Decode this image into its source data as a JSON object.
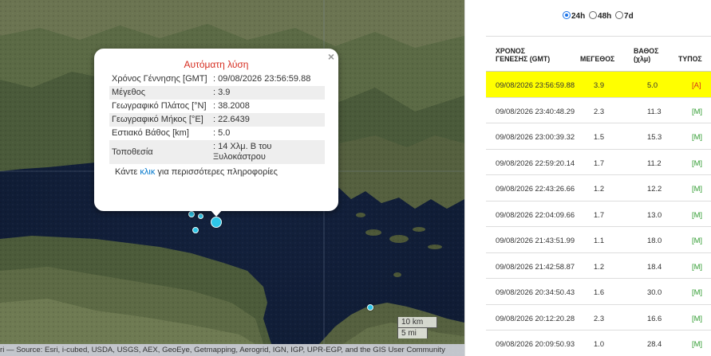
{
  "popup": {
    "title": "Αυτόματη λύση",
    "close": "×",
    "fields": [
      {
        "label": "Χρόνος Γέννησης [GMT]",
        "value": ": 09/08/2026 23:56:59.88"
      },
      {
        "label": "Μέγεθος",
        "value": ": 3.9"
      },
      {
        "label": "Γεωγραφικό Πλάτος [°N]",
        "value": ": 38.2008"
      },
      {
        "label": "Γεωγραφικό Μήκος [°E]",
        "value": ": 22.6439"
      },
      {
        "label": "Εστιακό Βάθος [km]",
        "value": ": 5.0"
      },
      {
        "label": "Τοποθεσία",
        "value": ": 14 Χλμ. Β του Ξυλοκάστρου"
      }
    ],
    "more_prefix": "Κάντε ",
    "more_link": "κλικ",
    "more_suffix": " για περισσότερες πληροφορίες"
  },
  "map": {
    "scale_km": "10 km",
    "scale_mi": "5 mi",
    "attribution": "ri — Source: Esri, i-cubed, USDA, USGS, AEX, GeoEye, Getmapping, Aerogrid, IGN, IGP, UPR-EGP, and the GIS User Community",
    "marker_color": "#2ec6e8"
  },
  "filters": {
    "options": [
      {
        "label": "24h",
        "selected": true
      },
      {
        "label": "48h",
        "selected": false
      },
      {
        "label": "7d",
        "selected": false
      }
    ]
  },
  "table": {
    "headers": {
      "time": [
        "ΧΡΟΝΟΣ",
        "ΓΕΝΕΣΗΣ (GMT)"
      ],
      "magnitude": "ΜΕΓΕΘΟΣ",
      "depth": [
        "ΒΑΘΟΣ",
        "(χλμ)"
      ],
      "type": "ΤΥΠΟΣ"
    },
    "highlight_color": "#ffff00",
    "rows": [
      {
        "time": "09/08/2026 23:56:59.88",
        "mag": "3.9",
        "depth": "5.0",
        "type": "[A]"
      },
      {
        "time": "09/08/2026 23:40:48.29",
        "mag": "2.3",
        "depth": "11.3",
        "type": "[M]"
      },
      {
        "time": "09/08/2026 23:00:39.32",
        "mag": "1.5",
        "depth": "15.3",
        "type": "[M]"
      },
      {
        "time": "09/08/2026 22:59:20.14",
        "mag": "1.7",
        "depth": "11.2",
        "type": "[M]"
      },
      {
        "time": "09/08/2026 22:43:26.66",
        "mag": "1.2",
        "depth": "12.2",
        "type": "[M]"
      },
      {
        "time": "09/08/2026 22:04:09.66",
        "mag": "1.7",
        "depth": "13.0",
        "type": "[M]"
      },
      {
        "time": "09/08/2026 21:43:51.99",
        "mag": "1.1",
        "depth": "18.0",
        "type": "[M]"
      },
      {
        "time": "09/08/2026 21:42:58.87",
        "mag": "1.2",
        "depth": "18.4",
        "type": "[M]"
      },
      {
        "time": "09/08/2026 20:34:50.43",
        "mag": "1.6",
        "depth": "30.0",
        "type": "[M]"
      },
      {
        "time": "09/08/2026 20:12:20.28",
        "mag": "2.3",
        "depth": "16.6",
        "type": "[M]"
      },
      {
        "time": "09/08/2026 20:09:50.93",
        "mag": "1.0",
        "depth": "28.4",
        "type": "[M]"
      }
    ]
  }
}
